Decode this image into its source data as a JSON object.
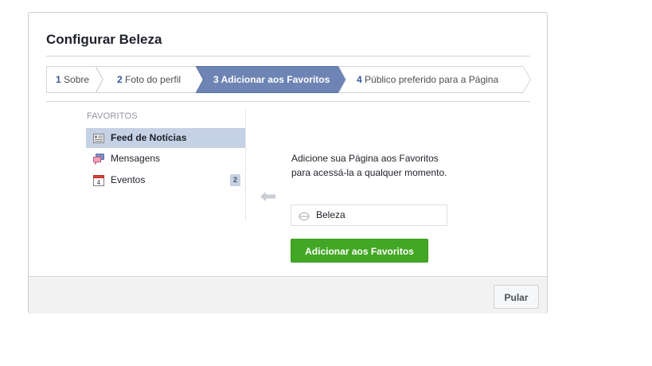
{
  "dialog": {
    "title": "Configurar Beleza"
  },
  "steps": [
    {
      "num": "1",
      "label": "Sobre",
      "active": false
    },
    {
      "num": "2",
      "label": "Foto do perfil",
      "active": false
    },
    {
      "num": "3",
      "label": "Adicionar aos Favoritos",
      "active": true
    },
    {
      "num": "4",
      "label": "Público preferido para a Página",
      "active": false
    }
  ],
  "favorites": {
    "heading": "FAVORITOS",
    "items": [
      {
        "label": "Feed de Notícias",
        "icon": "news-feed-icon",
        "selected": true
      },
      {
        "label": "Mensagens",
        "icon": "messages-icon",
        "selected": false
      },
      {
        "label": "Eventos",
        "icon": "calendar-icon",
        "icon_text": "4",
        "selected": false,
        "badge": "2"
      }
    ]
  },
  "main": {
    "description": "Adicione sua Página aos Favoritos para acessá-la a qualquer momento.",
    "page_name": "Beleza",
    "add_button": "Adicionar aos Favoritos"
  },
  "footer": {
    "skip_button": "Pular"
  },
  "colors": {
    "active_step": "#6d84b4",
    "selected_item": "#c5d1e4",
    "add_button": "#42a724",
    "accent_text": "#365899"
  }
}
